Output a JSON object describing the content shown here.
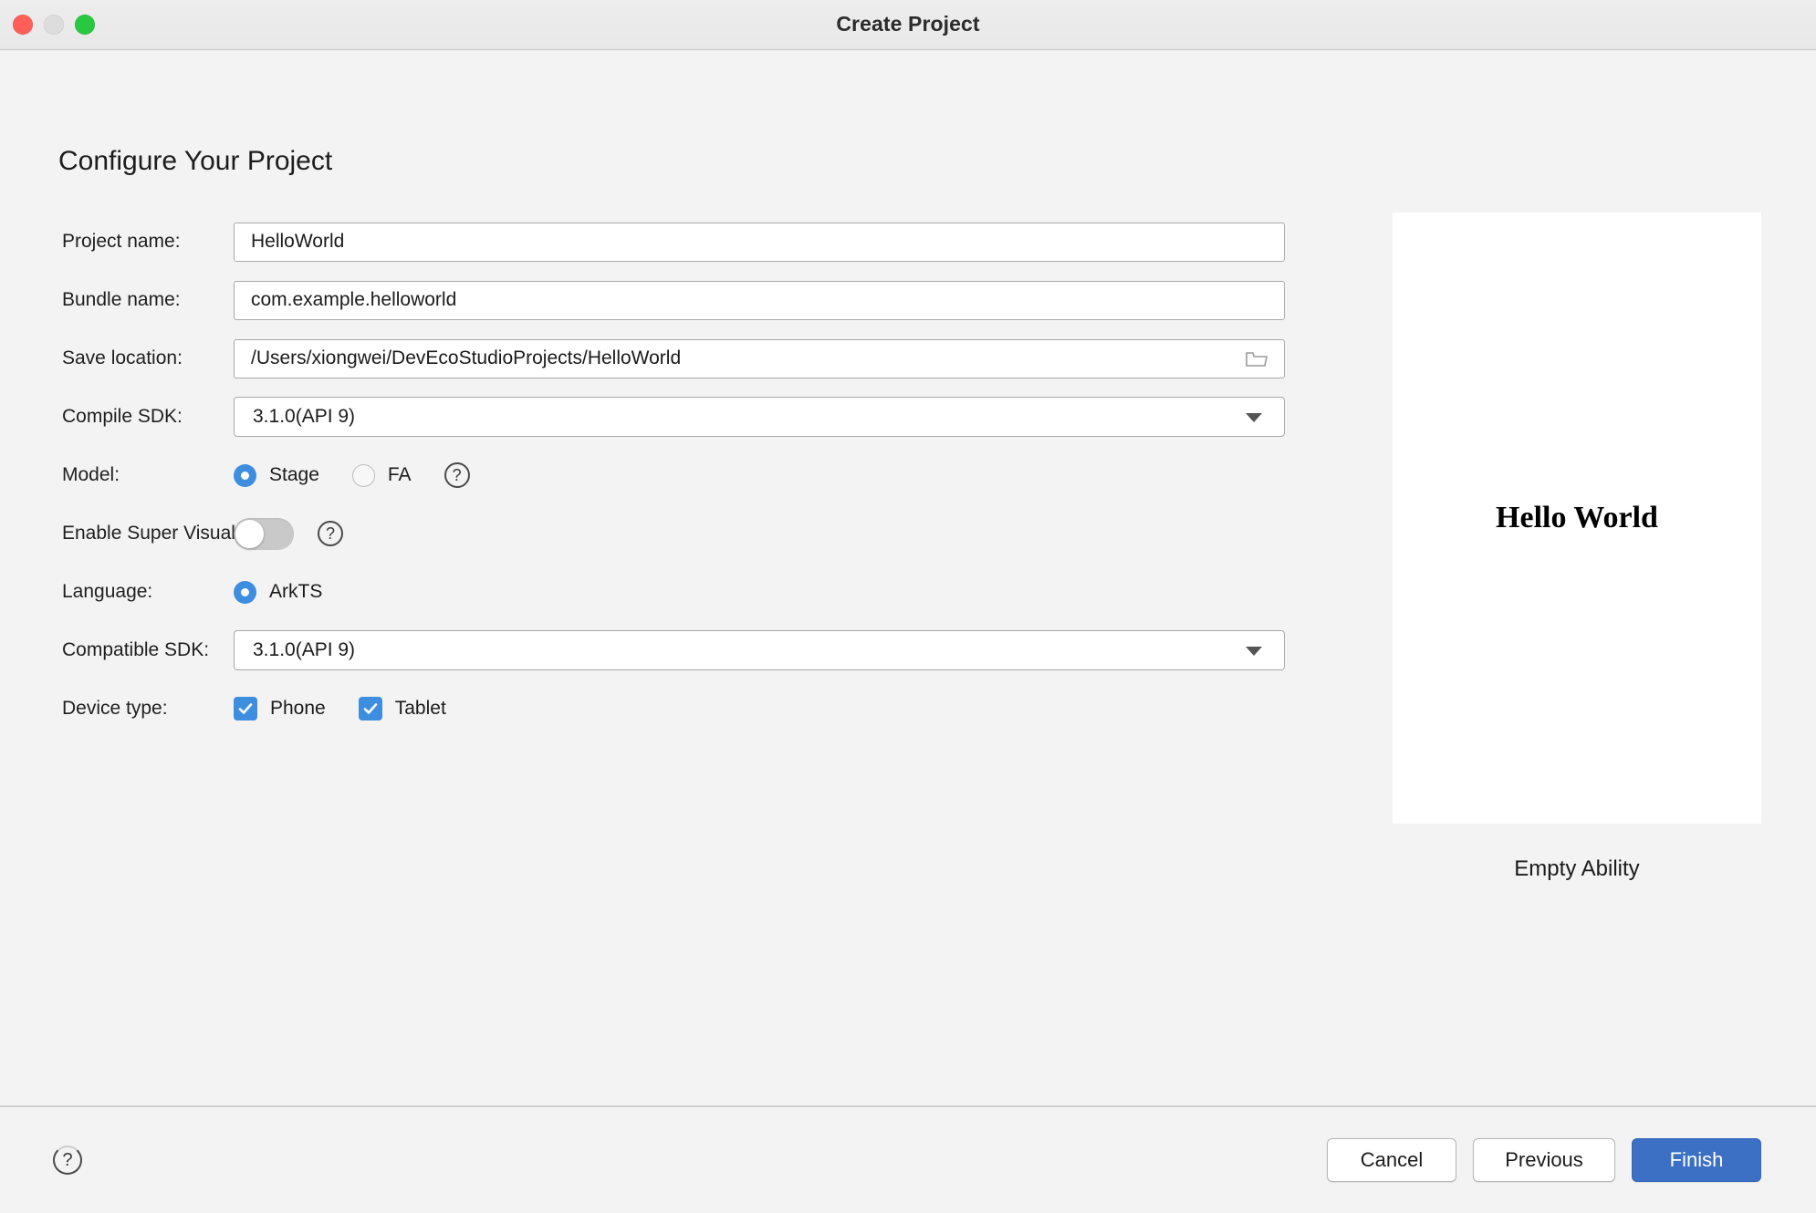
{
  "window": {
    "title": "Create Project",
    "traffic_lights": [
      "close",
      "minimize",
      "zoom"
    ]
  },
  "page": {
    "heading": "Configure Your Project"
  },
  "form": {
    "project_name": {
      "label": "Project name:",
      "value": "HelloWorld"
    },
    "bundle_name": {
      "label": "Bundle name:",
      "value": "com.example.helloworld"
    },
    "save_location": {
      "label": "Save location:",
      "value": "/Users/xiongwei/DevEcoStudioProjects/HelloWorld",
      "browse_icon": "folder-icon"
    },
    "compile_sdk": {
      "label": "Compile SDK:",
      "value": "3.1.0(API 9)"
    },
    "model": {
      "label": "Model:",
      "options": [
        "Stage",
        "FA"
      ],
      "selected": "Stage",
      "help_icon": "question-mark-icon"
    },
    "enable_super_visual": {
      "label": "Enable Super Visual:",
      "state": "off",
      "help_icon": "question-mark-icon"
    },
    "language": {
      "label": "Language:",
      "options": [
        "ArkTS"
      ],
      "selected": "ArkTS"
    },
    "compatible_sdk": {
      "label": "Compatible SDK:",
      "value": "3.1.0(API 9)"
    },
    "device_type": {
      "label": "Device type:",
      "options": [
        {
          "label": "Phone",
          "checked": true
        },
        {
          "label": "Tablet",
          "checked": true
        }
      ]
    }
  },
  "preview": {
    "screen_text": "Hello World",
    "caption": "Empty Ability"
  },
  "footer": {
    "help_icon": "question-mark-icon",
    "cancel_label": "Cancel",
    "previous_label": "Previous",
    "finish_label": "Finish"
  },
  "colors": {
    "accent_blue": "#3e8ee0",
    "primary_button": "#3c70c4",
    "window_bg": "#f3f3f3",
    "close_red": "#ff5f57",
    "zoom_green": "#28c840"
  }
}
